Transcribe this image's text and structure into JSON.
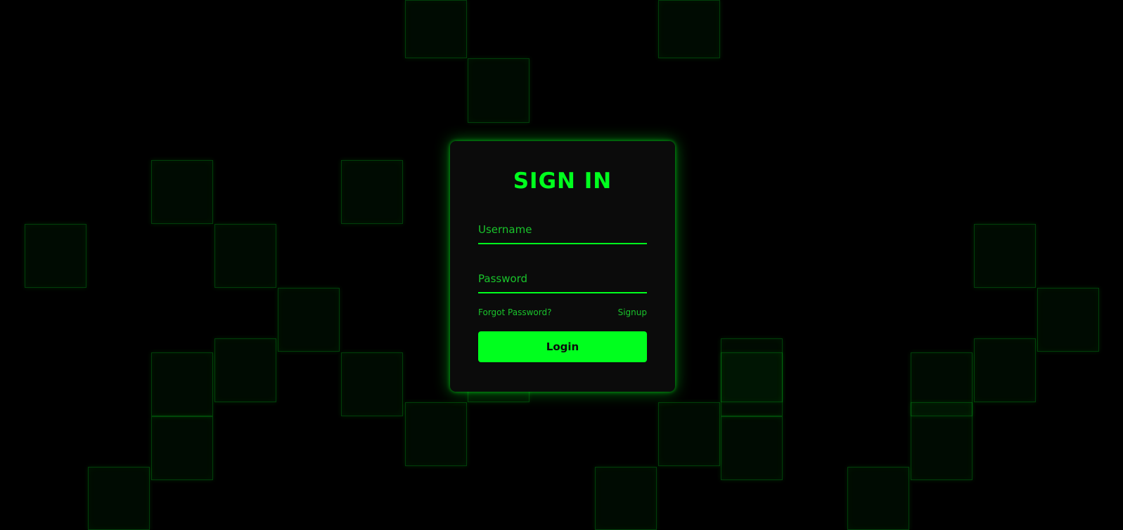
{
  "theme": {
    "background": "#000000",
    "accent": "#00ff1e",
    "card_background": "#0b0b0b"
  },
  "signin": {
    "title": "SIGN IN",
    "username_placeholder": "Username",
    "password_placeholder": "Password",
    "forgot_label": "Forgot Password?",
    "signup_label": "Signup",
    "login_label": "Login"
  }
}
